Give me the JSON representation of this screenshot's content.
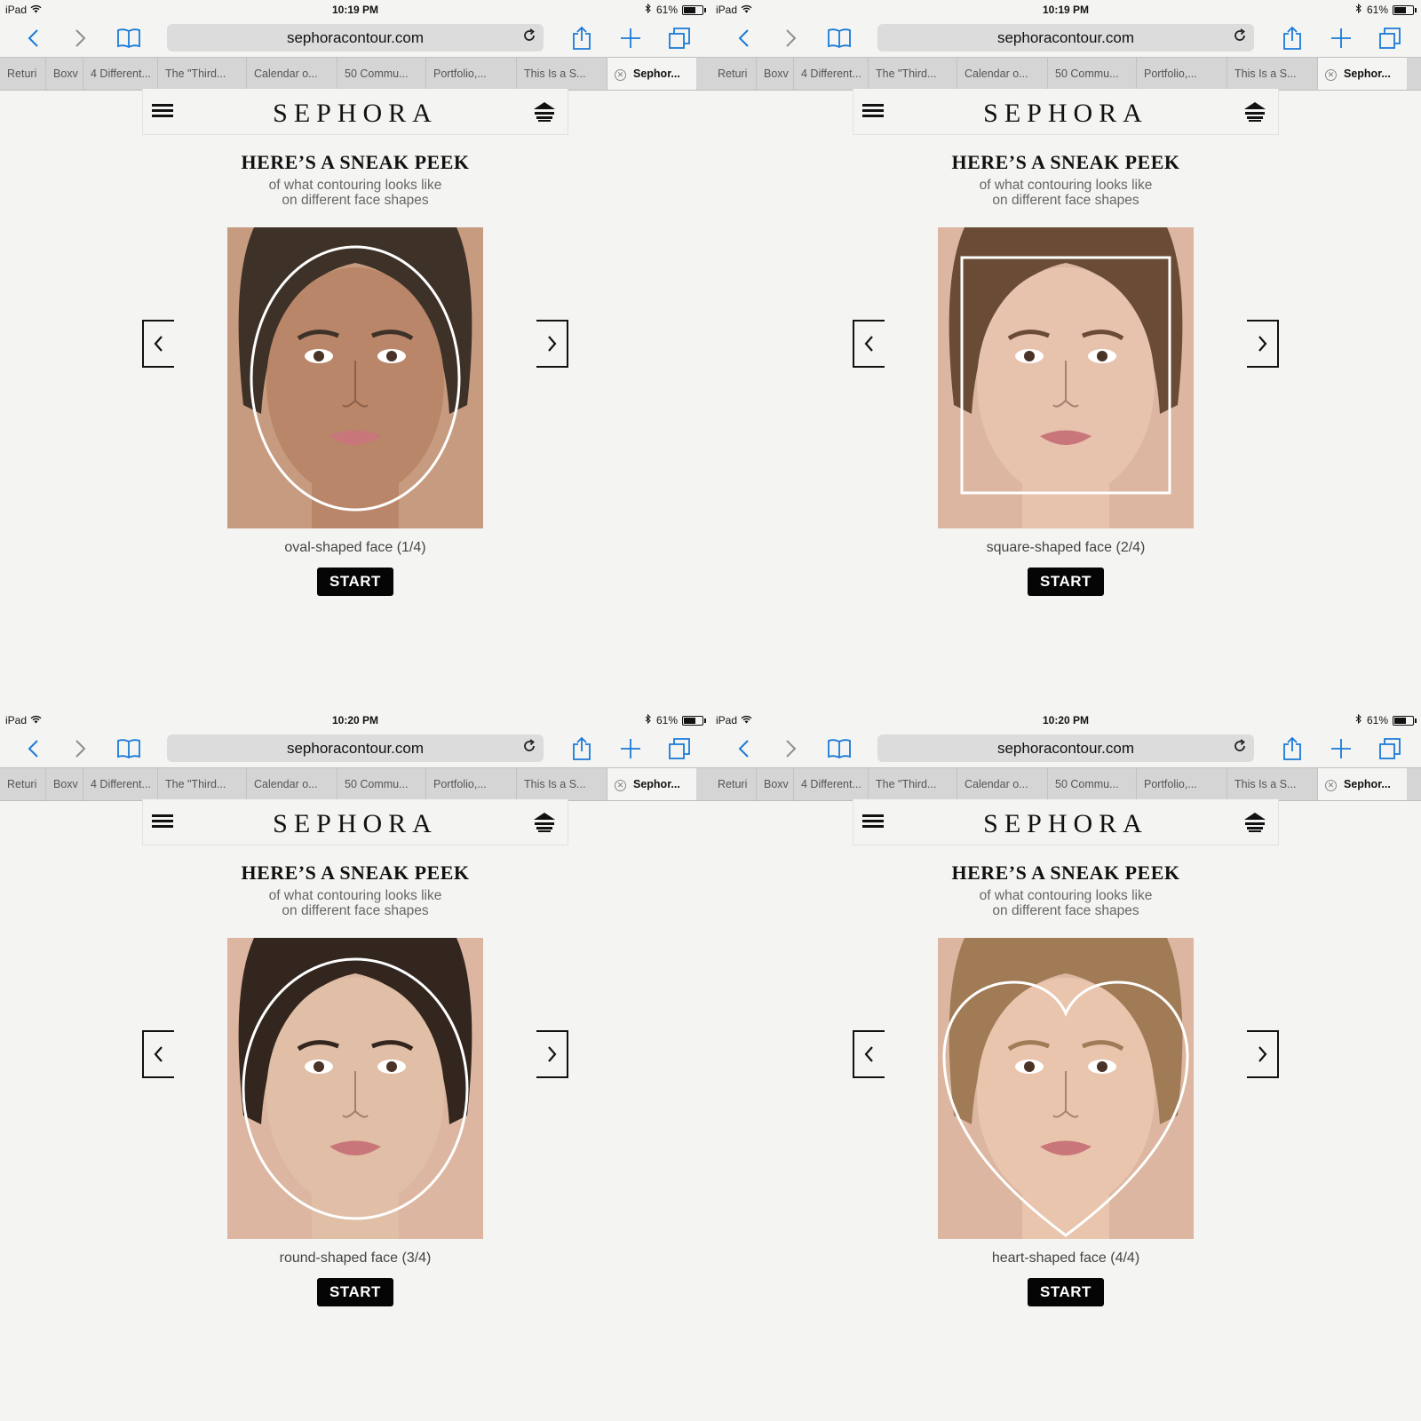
{
  "browser": {
    "url": "sephoracontour.com",
    "battery": "61%",
    "device": "iPad",
    "tabs": [
      "Returi",
      "Boxv",
      "4 Different...",
      "The \"Third...",
      "Calendar o...",
      "50 Commu...",
      "Portfolio,...",
      "This Is a S...",
      "Sephor..."
    ]
  },
  "site": {
    "logo": "SEPHORA",
    "headline": "HERE’S A SNEAK PEEK",
    "subline1": "of what contouring looks like",
    "subline2": "on different face shapes",
    "start": "START"
  },
  "panes": [
    {
      "time": "10:19 PM",
      "caption": "oval-shaped face (1/4)",
      "shape": "oval",
      "skin": "#b98669",
      "hair": "#3d3128"
    },
    {
      "time": "10:19 PM",
      "caption": "square-shaped face (2/4)",
      "shape": "square",
      "skin": "#e7c2ad",
      "hair": "#6a4b36"
    },
    {
      "time": "10:20 PM",
      "caption": "round-shaped face (3/4)",
      "shape": "round",
      "skin": "#e1bfa7",
      "hair": "#32261f"
    },
    {
      "time": "10:20 PM",
      "caption": "heart-shaped face (4/4)",
      "shape": "heart",
      "skin": "#eac5ae",
      "hair": "#a07b56"
    }
  ]
}
